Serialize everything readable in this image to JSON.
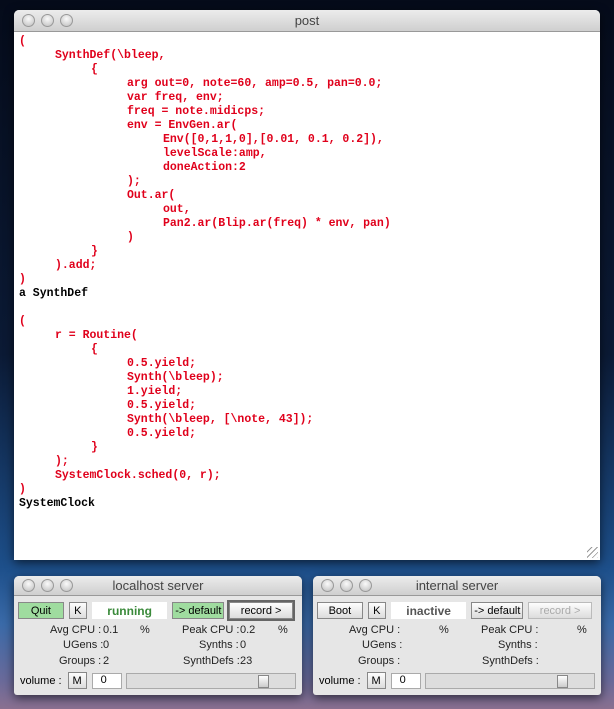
{
  "post": {
    "title": "post",
    "lines": [
      {
        "t": "(",
        "i": 0,
        "c": "red"
      },
      {
        "t": "SynthDef(\\bleep,",
        "i": 1,
        "c": "red"
      },
      {
        "t": "{",
        "i": 2,
        "c": "red"
      },
      {
        "t": "arg out=0, note=60, amp=0.5, pan=0.0;",
        "i": 3,
        "c": "red"
      },
      {
        "t": "var freq, env;",
        "i": 3,
        "c": "red"
      },
      {
        "t": "freq = note.midicps;",
        "i": 3,
        "c": "red"
      },
      {
        "t": "env = EnvGen.ar(",
        "i": 3,
        "c": "red"
      },
      {
        "t": "Env([0,1,1,0],[0.01, 0.1, 0.2]),",
        "i": 4,
        "c": "red"
      },
      {
        "t": "levelScale:amp,",
        "i": 4,
        "c": "red"
      },
      {
        "t": "doneAction:2",
        "i": 4,
        "c": "red"
      },
      {
        "t": ");",
        "i": 3,
        "c": "red"
      },
      {
        "t": "Out.ar(",
        "i": 3,
        "c": "red"
      },
      {
        "t": "out,",
        "i": 4,
        "c": "red"
      },
      {
        "t": "Pan2.ar(Blip.ar(freq) * env, pan)",
        "i": 4,
        "c": "red"
      },
      {
        "t": ")",
        "i": 3,
        "c": "red"
      },
      {
        "t": "}",
        "i": 2,
        "c": "red"
      },
      {
        "t": ").add;",
        "i": 1,
        "c": "red"
      },
      {
        "t": ")",
        "i": 0,
        "c": "red"
      },
      {
        "t": "a SynthDef",
        "i": 0,
        "c": "blk"
      },
      {
        "t": "",
        "i": 0,
        "c": "blk"
      },
      {
        "t": "(",
        "i": 0,
        "c": "red"
      },
      {
        "t": "r = Routine(",
        "i": 1,
        "c": "red"
      },
      {
        "t": "{",
        "i": 2,
        "c": "red"
      },
      {
        "t": "0.5.yield;",
        "i": 3,
        "c": "red"
      },
      {
        "t": "Synth(\\bleep);",
        "i": 3,
        "c": "red"
      },
      {
        "t": "1.yield;",
        "i": 3,
        "c": "red"
      },
      {
        "t": "0.5.yield;",
        "i": 3,
        "c": "red"
      },
      {
        "t": "Synth(\\bleep, [\\note, 43]);",
        "i": 3,
        "c": "red"
      },
      {
        "t": "0.5.yield;",
        "i": 3,
        "c": "red"
      },
      {
        "t": "}",
        "i": 2,
        "c": "red"
      },
      {
        "t": ");",
        "i": 1,
        "c": "red"
      },
      {
        "t": "SystemClock.sched(0, r);",
        "i": 1,
        "c": "red"
      },
      {
        "t": ")",
        "i": 0,
        "c": "red"
      },
      {
        "t": "SystemClock",
        "i": 0,
        "c": "blk"
      }
    ]
  },
  "localhost": {
    "title": "localhost server",
    "boot": "Quit",
    "kill": "K",
    "status": "running",
    "status_color": "#3a8a3a",
    "default": "-> default",
    "record": "record >",
    "avg_cpu_label": "Avg CPU :",
    "avg_cpu": "0.1",
    "pct": "%",
    "peak_cpu_label": "Peak CPU :",
    "peak_cpu": "0.2",
    "ugens_label": "UGens :",
    "ugens": "0",
    "synths_label": "Synths :",
    "synths": "0",
    "groups_label": "Groups :",
    "groups": "2",
    "synthdefs_label": "SynthDefs :",
    "synthdefs": "23",
    "volume_label": "volume :",
    "mute": "M",
    "volume": "0",
    "volume_slider": 0.85
  },
  "internal": {
    "title": "internal server",
    "boot": "Boot",
    "kill": "K",
    "status": "inactive",
    "status_color": "#555555",
    "default": "-> default",
    "record": "record >",
    "avg_cpu_label": "Avg CPU :",
    "pct": "%",
    "peak_cpu_label": "Peak CPU :",
    "ugens_label": "UGens :",
    "synths_label": "Synths :",
    "groups_label": "Groups :",
    "synthdefs_label": "SynthDefs :",
    "volume_label": "volume :",
    "mute": "M",
    "volume": "0",
    "volume_slider": 0.85
  }
}
